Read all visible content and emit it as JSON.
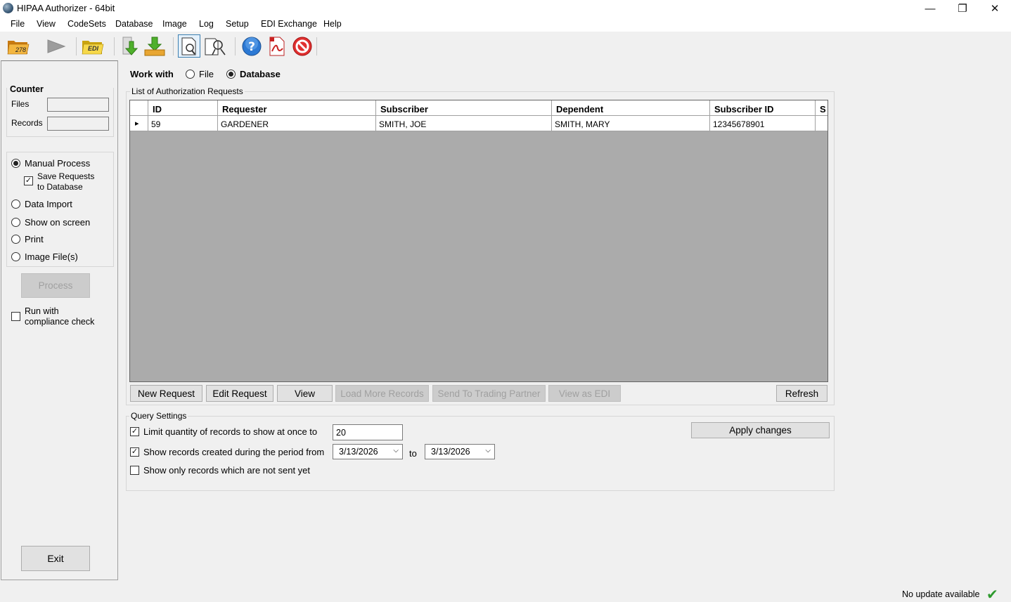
{
  "window": {
    "title": "HIPAA Authorizer - 64bit",
    "controls": {
      "minimize": "—",
      "restore": "❐",
      "close": "✕"
    }
  },
  "menu": [
    "File",
    "View",
    "CodeSets",
    "Database",
    "Image",
    "Log",
    "Setup",
    "EDI Exchange",
    "Help"
  ],
  "toolbar": {
    "open_278_label": "278",
    "edi_label": "EDI",
    "icons": [
      "folder-278-icon",
      "play-icon",
      "folder-edi-icon",
      "download-icon",
      "import-icon",
      "search-document-icon",
      "inspect-document-icon",
      "help-icon",
      "pdf-icon",
      "stop-icon"
    ]
  },
  "left": {
    "counter_title": "Counter",
    "files_label": "Files",
    "records_label": "Records",
    "files_value": "",
    "records_value": "",
    "modes": {
      "manual": "Manual Process",
      "save_line1": "Save Requests",
      "save_line2": "to Database",
      "import": "Data Import",
      "show": "Show on screen",
      "print": "Print",
      "image": "Image File(s)"
    },
    "process_label": "Process",
    "compliance_line1": "Run with",
    "compliance_line2": "compliance check",
    "exit_label": "Exit"
  },
  "main": {
    "work_with_label": "Work with",
    "file_option": "File",
    "database_option": "Database",
    "list_title": "List of Authorization Requests",
    "columns": [
      "ID",
      "Requester",
      "Subscriber",
      "Dependent",
      "Subscriber ID",
      "S"
    ],
    "rows": [
      [
        "59",
        "GARDENER",
        "SMITH, JOE",
        "SMITH, MARY",
        "12345678901",
        ""
      ]
    ],
    "row_marker": "▸",
    "buttons": {
      "new_request": "New Request",
      "edit_request": "Edit Request",
      "view": "View",
      "load_more": "Load More Records",
      "send": "Send To Trading Partner",
      "view_edi": "View as EDI",
      "refresh": "Refresh"
    }
  },
  "query": {
    "title": "Query Settings",
    "limit_label": "Limit quantity of records to show at once to",
    "limit_value": "20",
    "period_label": "Show records created during the period from",
    "date_from": "3/13/2026",
    "to_label": "to",
    "date_to": "3/13/2026",
    "not_sent_label": "Show only records which are not sent yet",
    "apply_label": "Apply changes",
    "dropdown_glyph": "⌵"
  },
  "status": {
    "text": "No update available",
    "ok_glyph": "✔"
  }
}
